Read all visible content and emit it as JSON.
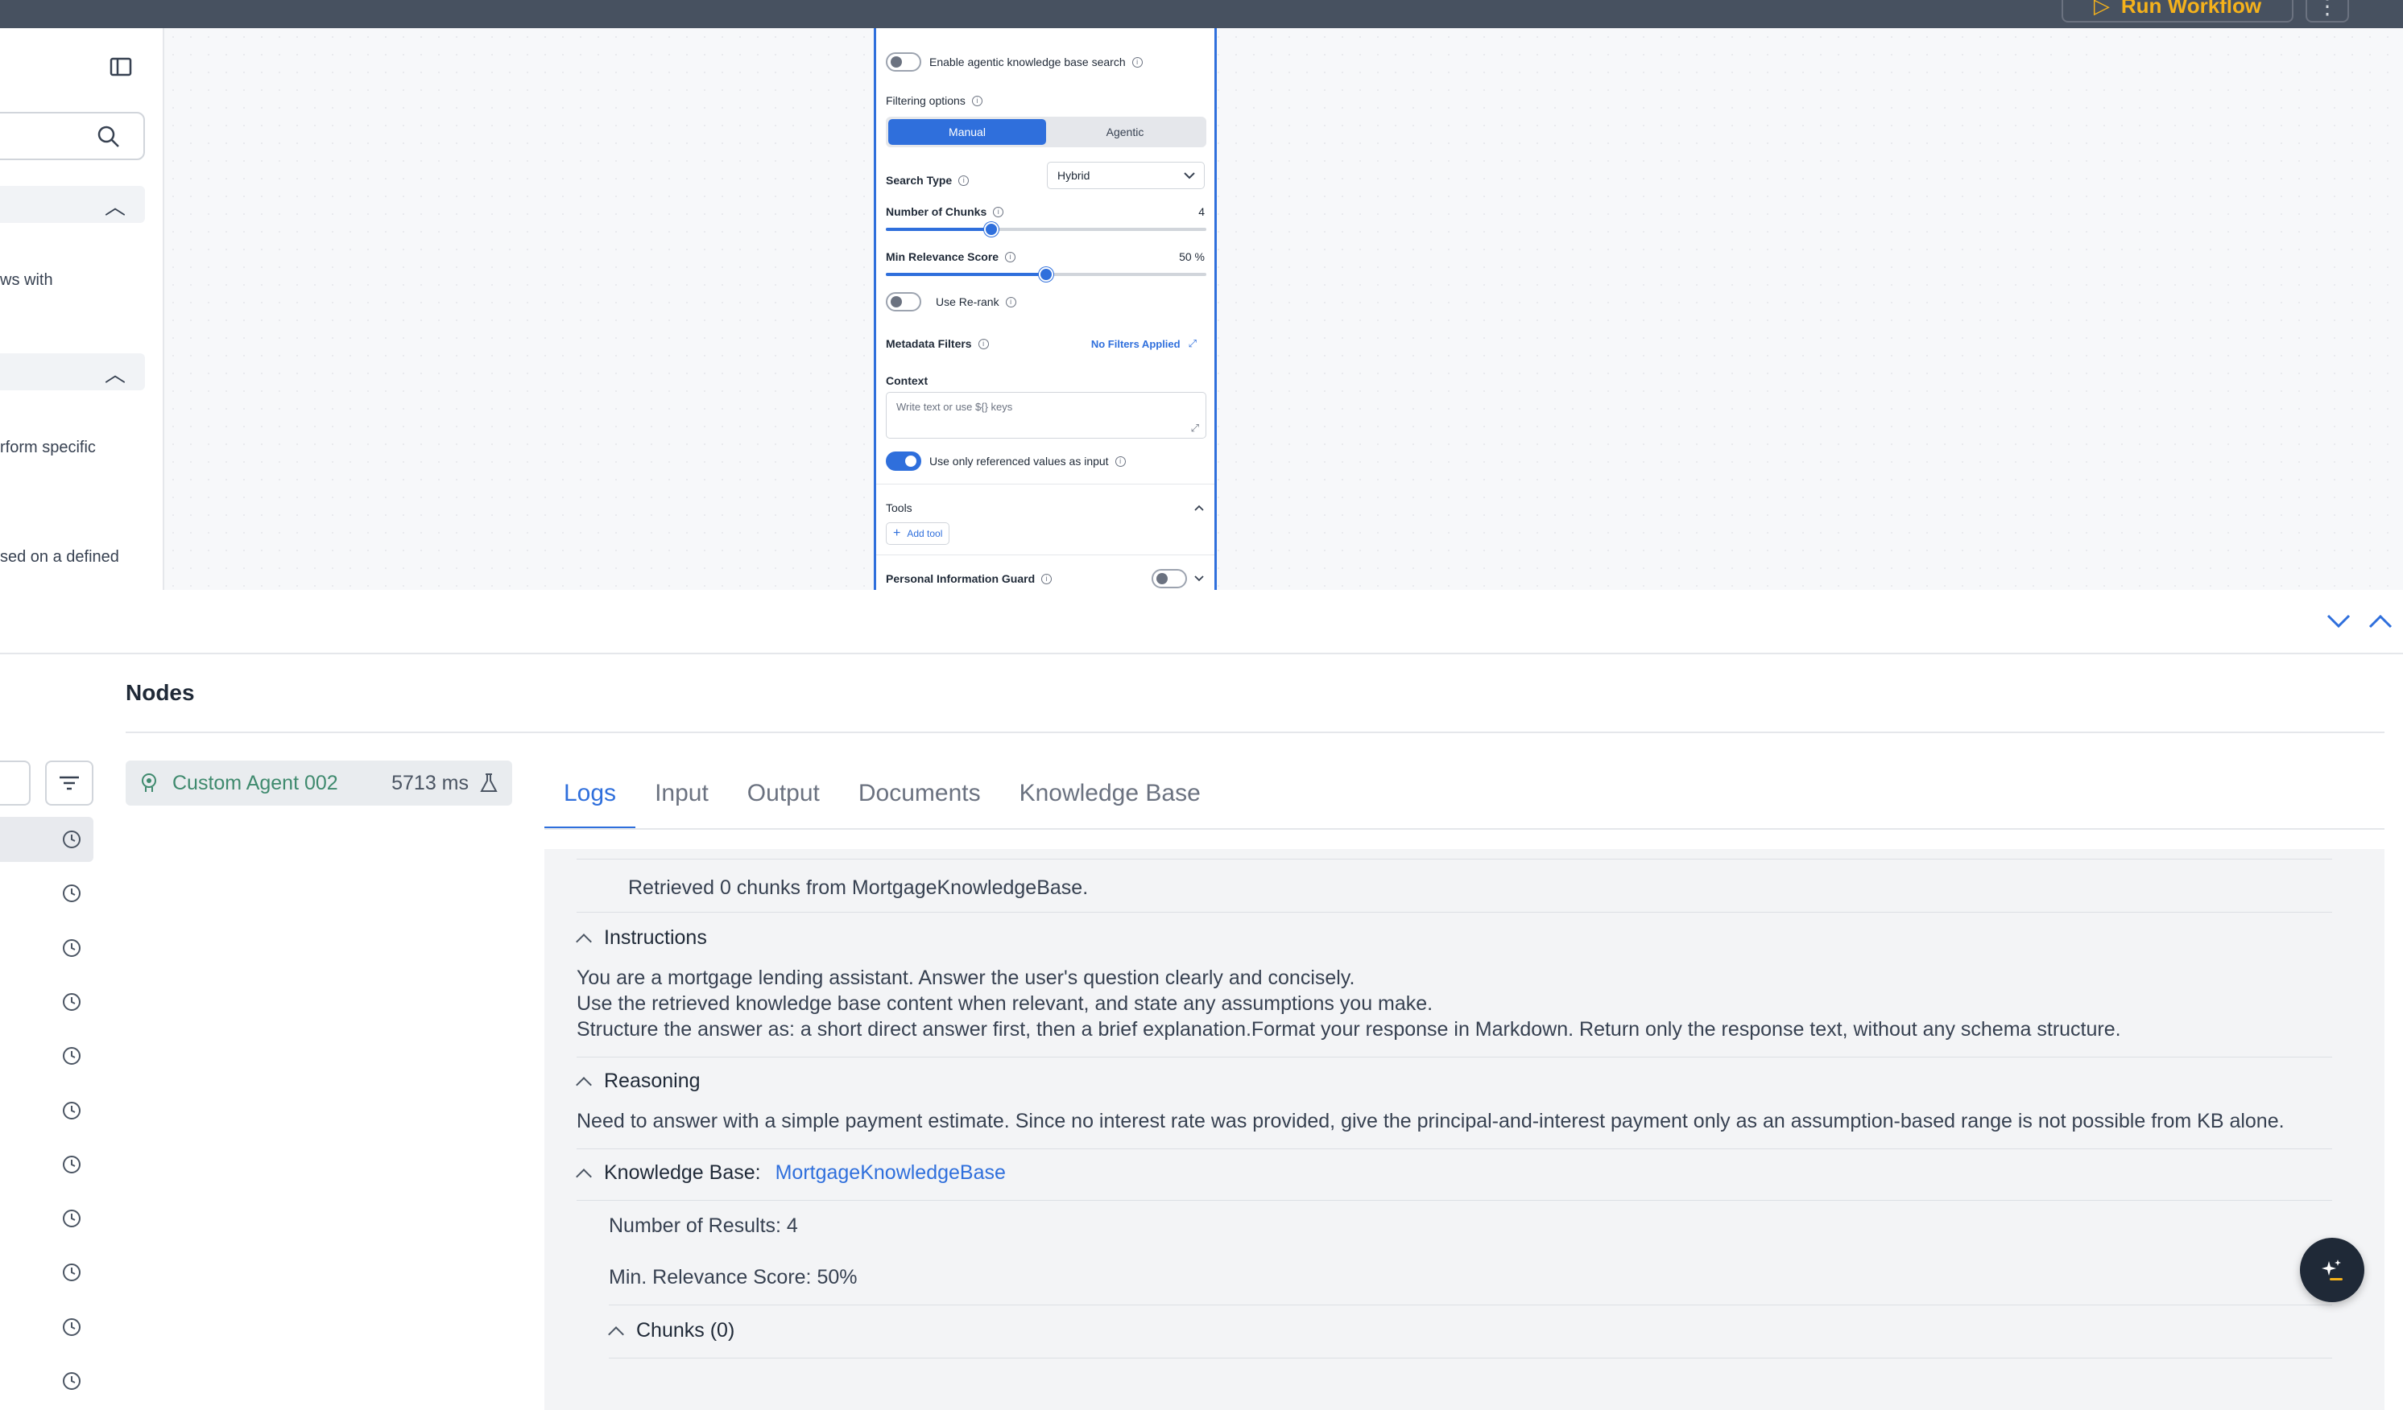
{
  "topbar": {
    "run_label": "Run Workflow",
    "more_label": "⋮"
  },
  "sidebar": {
    "snippets": [
      "ws with",
      "rform specific",
      "sed on a defined"
    ]
  },
  "node_panel": {
    "agentic_kb_search_label": "Enable agentic knowledge base search",
    "filtering_options_label": "Filtering options",
    "filter_modes": [
      "Manual",
      "Agentic"
    ],
    "active_filter_mode": "Manual",
    "search_type_label": "Search Type",
    "search_type_value": "Hybrid",
    "chunks_label": "Number of Chunks",
    "chunks_value": "4",
    "chunks_fraction": 0.33,
    "relevance_label": "Min Relevance Score",
    "relevance_value": "50 %",
    "relevance_fraction": 0.5,
    "rerank_label": "Use Re-rank",
    "metadata_label": "Metadata Filters",
    "metadata_value": "No Filters Applied",
    "context_label": "Context",
    "context_placeholder": "Write text or use ${} keys",
    "referenced_values_label": "Use only referenced values as input",
    "tools_label": "Tools",
    "add_tool_label": "Add tool",
    "pii_label": "Personal Information Guard"
  },
  "bottom": {
    "nodes_title": "Nodes",
    "agent": {
      "name": "Custom Agent 002",
      "duration": "5713 ms"
    },
    "tabs": [
      "Logs",
      "Input",
      "Output",
      "Documents",
      "Knowledge Base"
    ],
    "active_tab": "Logs",
    "logs": {
      "retrieved": "Retrieved 0 chunks from MortgageKnowledgeBase.",
      "instructions_title": "Instructions",
      "instructions": [
        "You are a mortgage lending assistant. Answer the user's question clearly and concisely.",
        "Use the retrieved knowledge base content when relevant, and state any assumptions you make.",
        "Structure the answer as: a short direct answer first, then a brief explanation.Format your response in Markdown. Return only the response text, without any schema structure."
      ],
      "reasoning_title": "Reasoning",
      "reasoning": "Need to answer with a simple payment estimate. Since no interest rate was provided, give the principal-and-interest payment only as an assumption-based range is not possible from KB alone.",
      "kb_title": "Knowledge Base:",
      "kb_name": "MortgageKnowledgeBase",
      "num_results": "Number of Results: 4",
      "min_relevance": "Min. Relevance Score: 50%",
      "chunks_title": "Chunks (0)"
    }
  },
  "colors": {
    "accent": "#2f6fdc",
    "topbar": "#475160",
    "run_text": "#f5b21b",
    "agent_name": "#3f8a6e"
  }
}
